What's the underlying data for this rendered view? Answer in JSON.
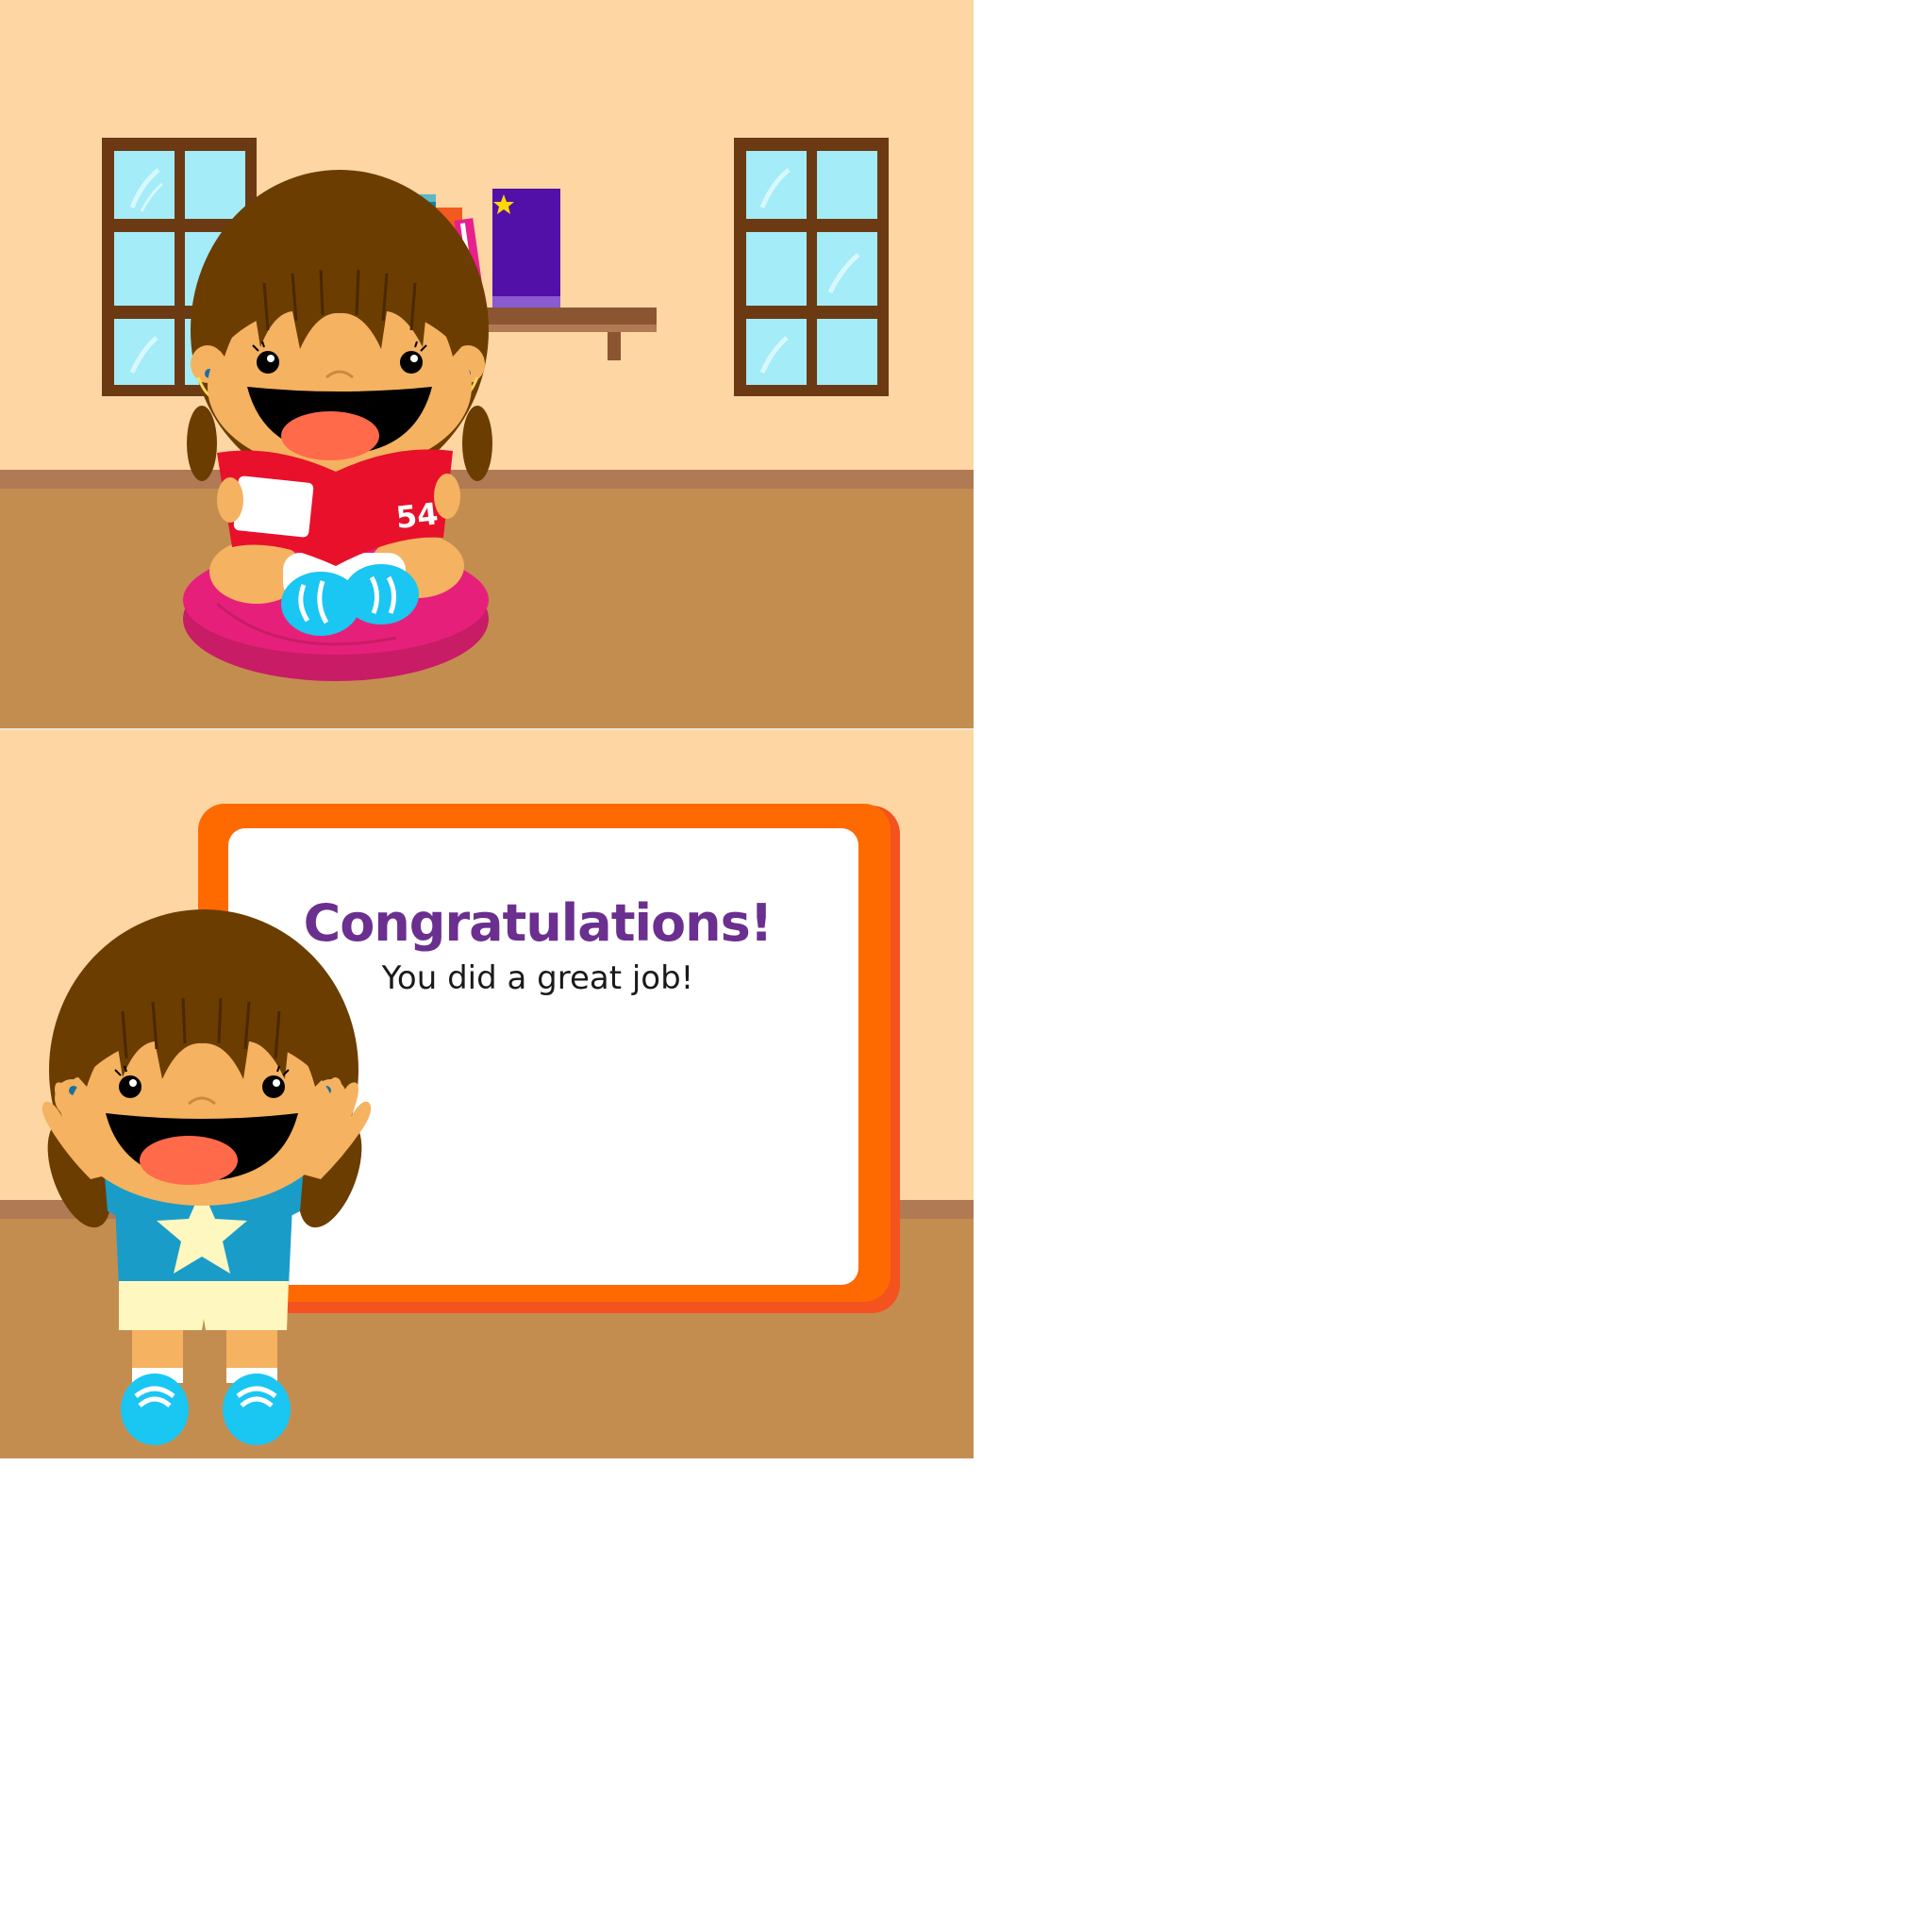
{
  "scene_reading": {
    "book_number": "54"
  },
  "scene_congrats": {
    "title": "Congratulations!",
    "subtitle": "You did a great job!"
  },
  "colors": {
    "wall": "#fdd6a3",
    "floor": "#c48d50",
    "baseboard": "#b07a55",
    "window_frame": "#6b3a12",
    "window_glass": "#a3ecf8",
    "book_cover": "#e8102a",
    "cushion": "#e6207a",
    "shoes": "#1ac6f2",
    "shirt": "#1a9cc8",
    "star": "#fff7c0",
    "shorts": "#fff7c0",
    "board_frame": "#ff6a00",
    "board_panel": "#ffffff",
    "title_text": "#6a2f8f"
  }
}
